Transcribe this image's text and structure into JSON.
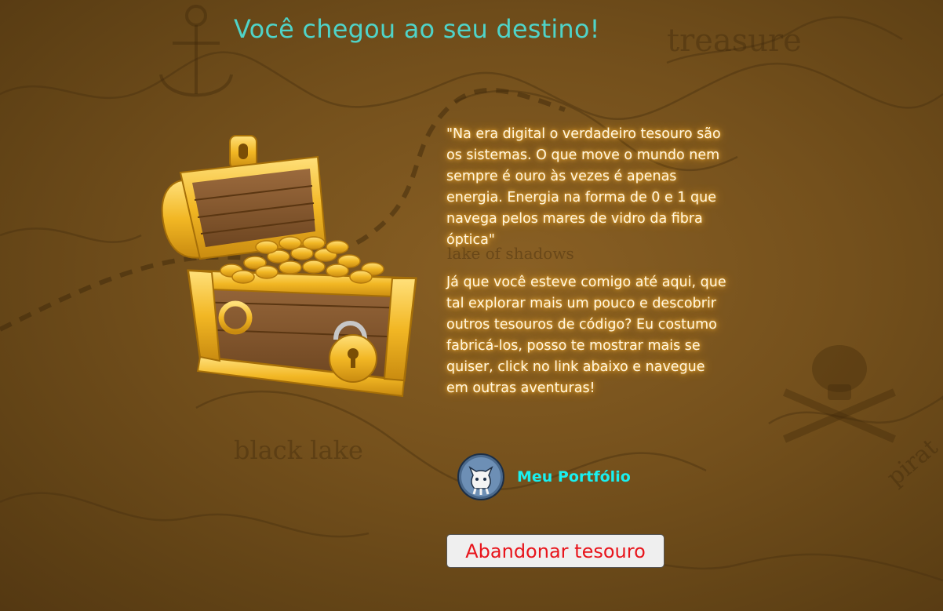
{
  "header": {
    "title": "Você chegou ao seu destino!"
  },
  "map": {
    "labels": [
      "treasure",
      "black lake",
      "lake of shadows",
      "pirat"
    ]
  },
  "content": {
    "quote": "\"Na era digital o verdadeiro tesouro são os sistemas. O que move o mundo nem sempre é ouro às vezes é apenas energia. Energia na forma de 0 e 1 que navega pelos mares de vidro da fibra óptica\"",
    "invitation": "Já que você esteve comigo até aqui, que tal explorar mais um pouco e descobrir outros tesouros de código? Eu costumo fabricá-los, posso te mostrar mais se quiser, click no link abaixo e navegue em outras aventuras!"
  },
  "portfolio": {
    "label": "Meu Portfólio",
    "icon": "github-octocat-icon"
  },
  "actions": {
    "abandon_label": "Abandonar tesouro"
  },
  "colors": {
    "title": "#4fd3c8",
    "portfolio_link": "#19f0f0",
    "abandon_text": "#e8141b",
    "background": "#74501c"
  }
}
